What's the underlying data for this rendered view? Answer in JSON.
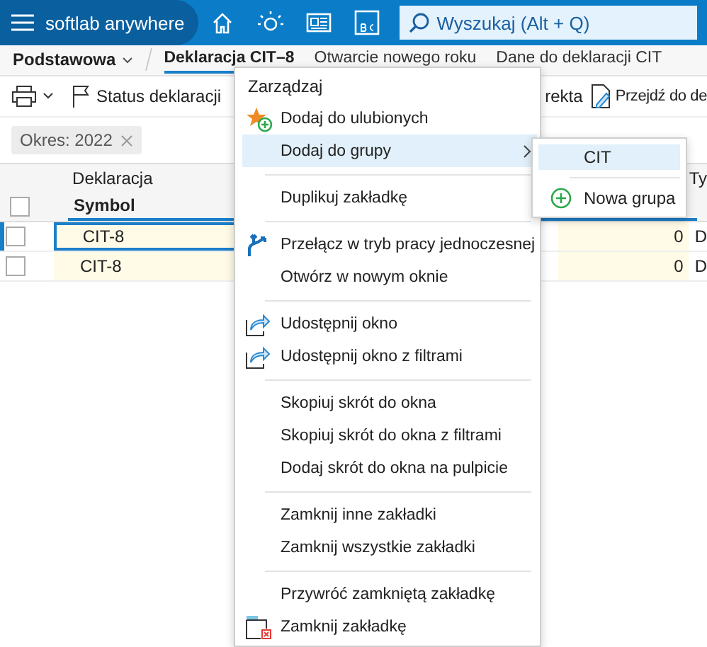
{
  "app": {
    "name": "softlab anywhere"
  },
  "search": {
    "placeholder": "Wyszukaj (Alt + Q)"
  },
  "workspace": {
    "label": "Podstawowa"
  },
  "tabs": [
    {
      "label": "Deklaracja CIT–8",
      "selected": true
    },
    {
      "label": "Otwarcie nowego roku",
      "selected": false
    },
    {
      "label": "Dane do deklaracji CIT",
      "selected": false
    }
  ],
  "toolbar": [
    {
      "kind": "print"
    },
    {
      "kind": "status",
      "label": "Status deklaracji"
    },
    {
      "kind": "plain",
      "label": "rekta"
    },
    {
      "kind": "goto",
      "label": "Przejdź do de"
    }
  ],
  "filter": {
    "label": "Okres: 2022"
  },
  "grid": {
    "group_header": "Deklaracja",
    "symbol_header": "Symbol",
    "column_4_header": "Ty",
    "all_checked": false,
    "rows": [
      {
        "symbol": "CIT-8",
        "column_3": "0",
        "column_4": "D",
        "selected": true,
        "checked": false
      },
      {
        "symbol": "CIT-8",
        "column_3": "0",
        "column_4": "D",
        "selected": false,
        "checked": false
      }
    ]
  },
  "menu": {
    "title": "Zarządzaj",
    "groups": [
      [
        {
          "label": "Dodaj do ulubionych",
          "kind": "favorite",
          "highlighted": false,
          "submenu": false
        },
        {
          "label": "Dodaj do grupy",
          "kind": "plain",
          "highlighted": true,
          "submenu": true
        }
      ],
      [
        {
          "label": "Duplikuj zakładkę",
          "kind": "plain",
          "highlighted": false,
          "submenu": false
        }
      ],
      [
        {
          "label": "Przełącz w tryb pracy jednoczesnej",
          "kind": "concurrent",
          "highlighted": false,
          "submenu": false
        },
        {
          "label": "Otwórz w nowym oknie",
          "kind": "plain",
          "highlighted": false,
          "submenu": false
        }
      ],
      [
        {
          "label": "Udostępnij okno",
          "kind": "share",
          "highlighted": false,
          "submenu": false
        },
        {
          "label": "Udostępnij okno z filtrami",
          "kind": "share",
          "highlighted": false,
          "submenu": false
        }
      ],
      [
        {
          "label": "Skopiuj skrót do okna",
          "kind": "plain",
          "highlighted": false,
          "submenu": false
        },
        {
          "label": "Skopiuj skrót do okna z filtrami",
          "kind": "plain",
          "highlighted": false,
          "submenu": false
        },
        {
          "label": "Dodaj skrót do okna na pulpicie",
          "kind": "plain",
          "highlighted": false,
          "submenu": false
        }
      ],
      [
        {
          "label": "Zamknij inne zakładki",
          "kind": "plain",
          "highlighted": false,
          "submenu": false
        },
        {
          "label": "Zamknij wszystkie zakładki",
          "kind": "plain",
          "highlighted": false,
          "submenu": false
        }
      ],
      [
        {
          "label": "Przywróć zamkniętą zakładkę",
          "kind": "plain",
          "highlighted": false,
          "submenu": false
        },
        {
          "label": "Zamknij zakładkę",
          "kind": "close",
          "highlighted": false,
          "submenu": false
        }
      ]
    ]
  },
  "submenu": {
    "groups": [
      [
        {
          "label": "CIT",
          "kind": "group",
          "highlighted": true
        }
      ],
      [
        {
          "label": "Nowa grupa",
          "kind": "new",
          "highlighted": false
        }
      ]
    ]
  }
}
